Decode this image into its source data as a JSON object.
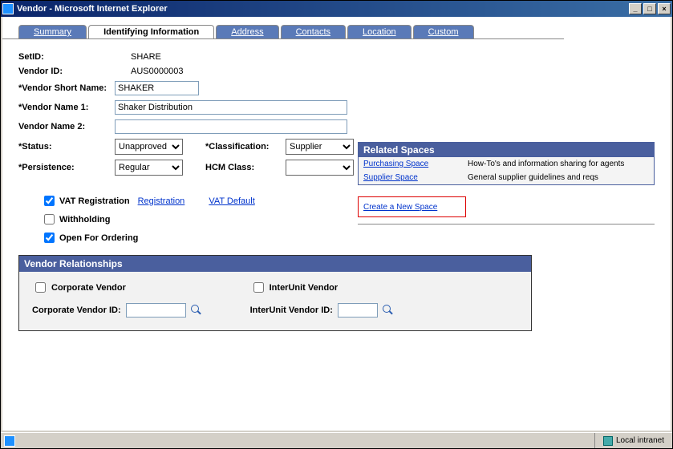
{
  "window": {
    "title": "Vendor - Microsoft Internet Explorer"
  },
  "tabs": {
    "summary": "Summary",
    "identifying": "Identifying Information",
    "address": "Address",
    "contacts": "Contacts",
    "location": "Location",
    "custom": "Custom"
  },
  "labels": {
    "setid": "SetID:",
    "vendor_id": "Vendor ID:",
    "vendor_short": "*Vendor Short Name:",
    "vendor_name1": "*Vendor Name 1:",
    "vendor_name2": "Vendor Name 2:",
    "status": "*Status:",
    "classification": "*Classification:",
    "persistence": "*Persistence:",
    "hcm_class": "HCM Class:",
    "vat_reg": "VAT Registration",
    "registration": "Registration",
    "vat_default": "VAT Default",
    "withholding": "Withholding",
    "open_ordering": "Open For Ordering",
    "vendor_relationships": "Vendor Relationships",
    "corp_vendor": "Corporate Vendor",
    "corp_vendor_id": "Corporate Vendor ID:",
    "interunit_vendor": "InterUnit Vendor",
    "interunit_vendor_id": "InterUnit Vendor ID:"
  },
  "values": {
    "setid": "SHARE",
    "vendor_id": "AUS0000003",
    "vendor_short": "SHAKER",
    "vendor_name1": "Shaker Distribution",
    "vendor_name2": "",
    "status": "Unapproved",
    "classification": "Supplier",
    "persistence": "Regular",
    "hcm_class": "",
    "corp_vendor_id": "",
    "interunit_vendor_id": "",
    "vat_reg_checked": true,
    "withholding_checked": false,
    "open_ordering_checked": true,
    "corp_vendor_checked": false,
    "interunit_vendor_checked": false
  },
  "related": {
    "title": "Related Spaces",
    "rows": [
      {
        "link": "Purchasing Space",
        "desc": "How-To's and information sharing for agents"
      },
      {
        "link": "Supplier Space",
        "desc": "General supplier guidelines and reqs"
      }
    ],
    "create_new": "Create a New Space"
  },
  "statusbar": {
    "zone": "Local intranet"
  }
}
